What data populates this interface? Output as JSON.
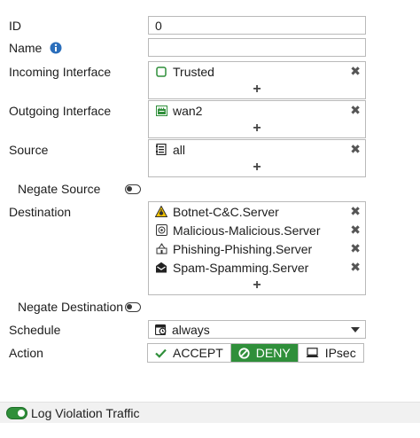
{
  "form": {
    "id": {
      "label": "ID",
      "value": "0"
    },
    "name": {
      "label": "Name",
      "value": "",
      "info_icon": "info-circle-icon"
    },
    "incoming": {
      "label": "Incoming Interface",
      "entries": [
        {
          "name": "Trusted",
          "icon": "zone-icon"
        }
      ],
      "add": "+"
    },
    "outgoing": {
      "label": "Outgoing Interface",
      "entries": [
        {
          "name": "wan2",
          "icon": "network-port-icon"
        }
      ],
      "add": "+"
    },
    "source": {
      "label": "Source",
      "entries": [
        {
          "name": "all",
          "icon": "address-icon"
        }
      ],
      "add": "+"
    },
    "negate_source": {
      "label": "Negate Source",
      "enabled": false
    },
    "destination": {
      "label": "Destination",
      "entries": [
        {
          "name": "Botnet-C&C.Server",
          "icon": "botnet-warning-icon"
        },
        {
          "name": "Malicious-Malicious.Server",
          "icon": "malicious-server-icon"
        },
        {
          "name": "Phishing-Phishing.Server",
          "icon": "phishing-icon"
        },
        {
          "name": "Spam-Spamming.Server",
          "icon": "spam-mail-icon"
        }
      ],
      "add": "+"
    },
    "negate_destination": {
      "label": "Negate Destination",
      "enabled": false
    },
    "schedule": {
      "label": "Schedule",
      "value": "always",
      "icon": "schedule-icon"
    },
    "action": {
      "label": "Action",
      "options": [
        {
          "label": "ACCEPT",
          "icon": "check-icon"
        },
        {
          "label": "DENY",
          "icon": "deny-icon"
        },
        {
          "label": "IPsec",
          "icon": "ipsec-icon"
        }
      ],
      "selected": "DENY"
    },
    "remove_symbol": "✖"
  },
  "footer": {
    "log_violation_label": "Log Violation Traffic",
    "enabled": true
  },
  "colors": {
    "accent_green": "#2f8f3a",
    "info_blue": "#2a6ebb",
    "border": "#b9b9b9"
  }
}
